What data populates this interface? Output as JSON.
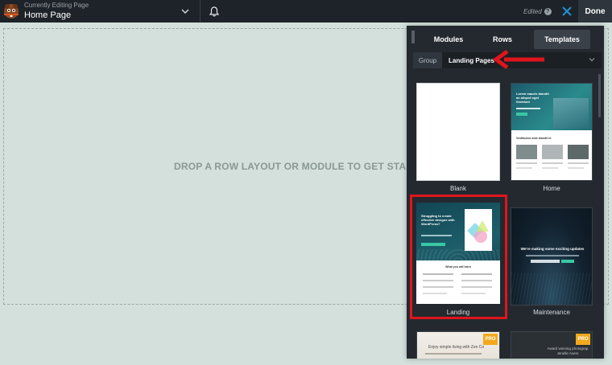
{
  "topbar": {
    "editing_label": "Currently Editing Page",
    "page_title": "Home Page",
    "edited_label": "Edited",
    "done_label": "Done"
  },
  "canvas": {
    "drop_text": "DROP A ROW LAYOUT OR MODULE TO GET STA"
  },
  "panel": {
    "tabs": [
      {
        "label": "Modules",
        "active": false
      },
      {
        "label": "Rows",
        "active": false
      },
      {
        "label": "Templates",
        "active": true
      }
    ],
    "group_label": "Group",
    "group_value": "Landing Pages",
    "templates": [
      {
        "label": "Blank",
        "pro": false
      },
      {
        "label": "Home",
        "pro": false,
        "hero_text": "Lorem mauris blandit an aliquet eget tincidunt",
        "section_text": "Vestibulum ante blandit id"
      },
      {
        "label": "Landing",
        "pro": false,
        "hero_text": "Struggling to create effective designs with WordPress?",
        "section_text": "What you will learn",
        "highlighted": true
      },
      {
        "label": "Maintenance",
        "pro": false,
        "hero_text": "We're making some exciting updates"
      },
      {
        "label": "",
        "pro": true,
        "pro_text": "PRO",
        "hero_text": "Enjoy simple living with Zen Co"
      },
      {
        "label": "",
        "pro": true,
        "pro_text": "PRO",
        "hero_text": "Award winning photograp Jenelle Avers"
      }
    ]
  },
  "colors": {
    "topbar_bg": "#1e2329",
    "accent_blue": "#1f93d4",
    "highlight_red": "#e0151b",
    "pro_badge": "#f2a91c",
    "canvas_bg": "#d3e0dc"
  }
}
